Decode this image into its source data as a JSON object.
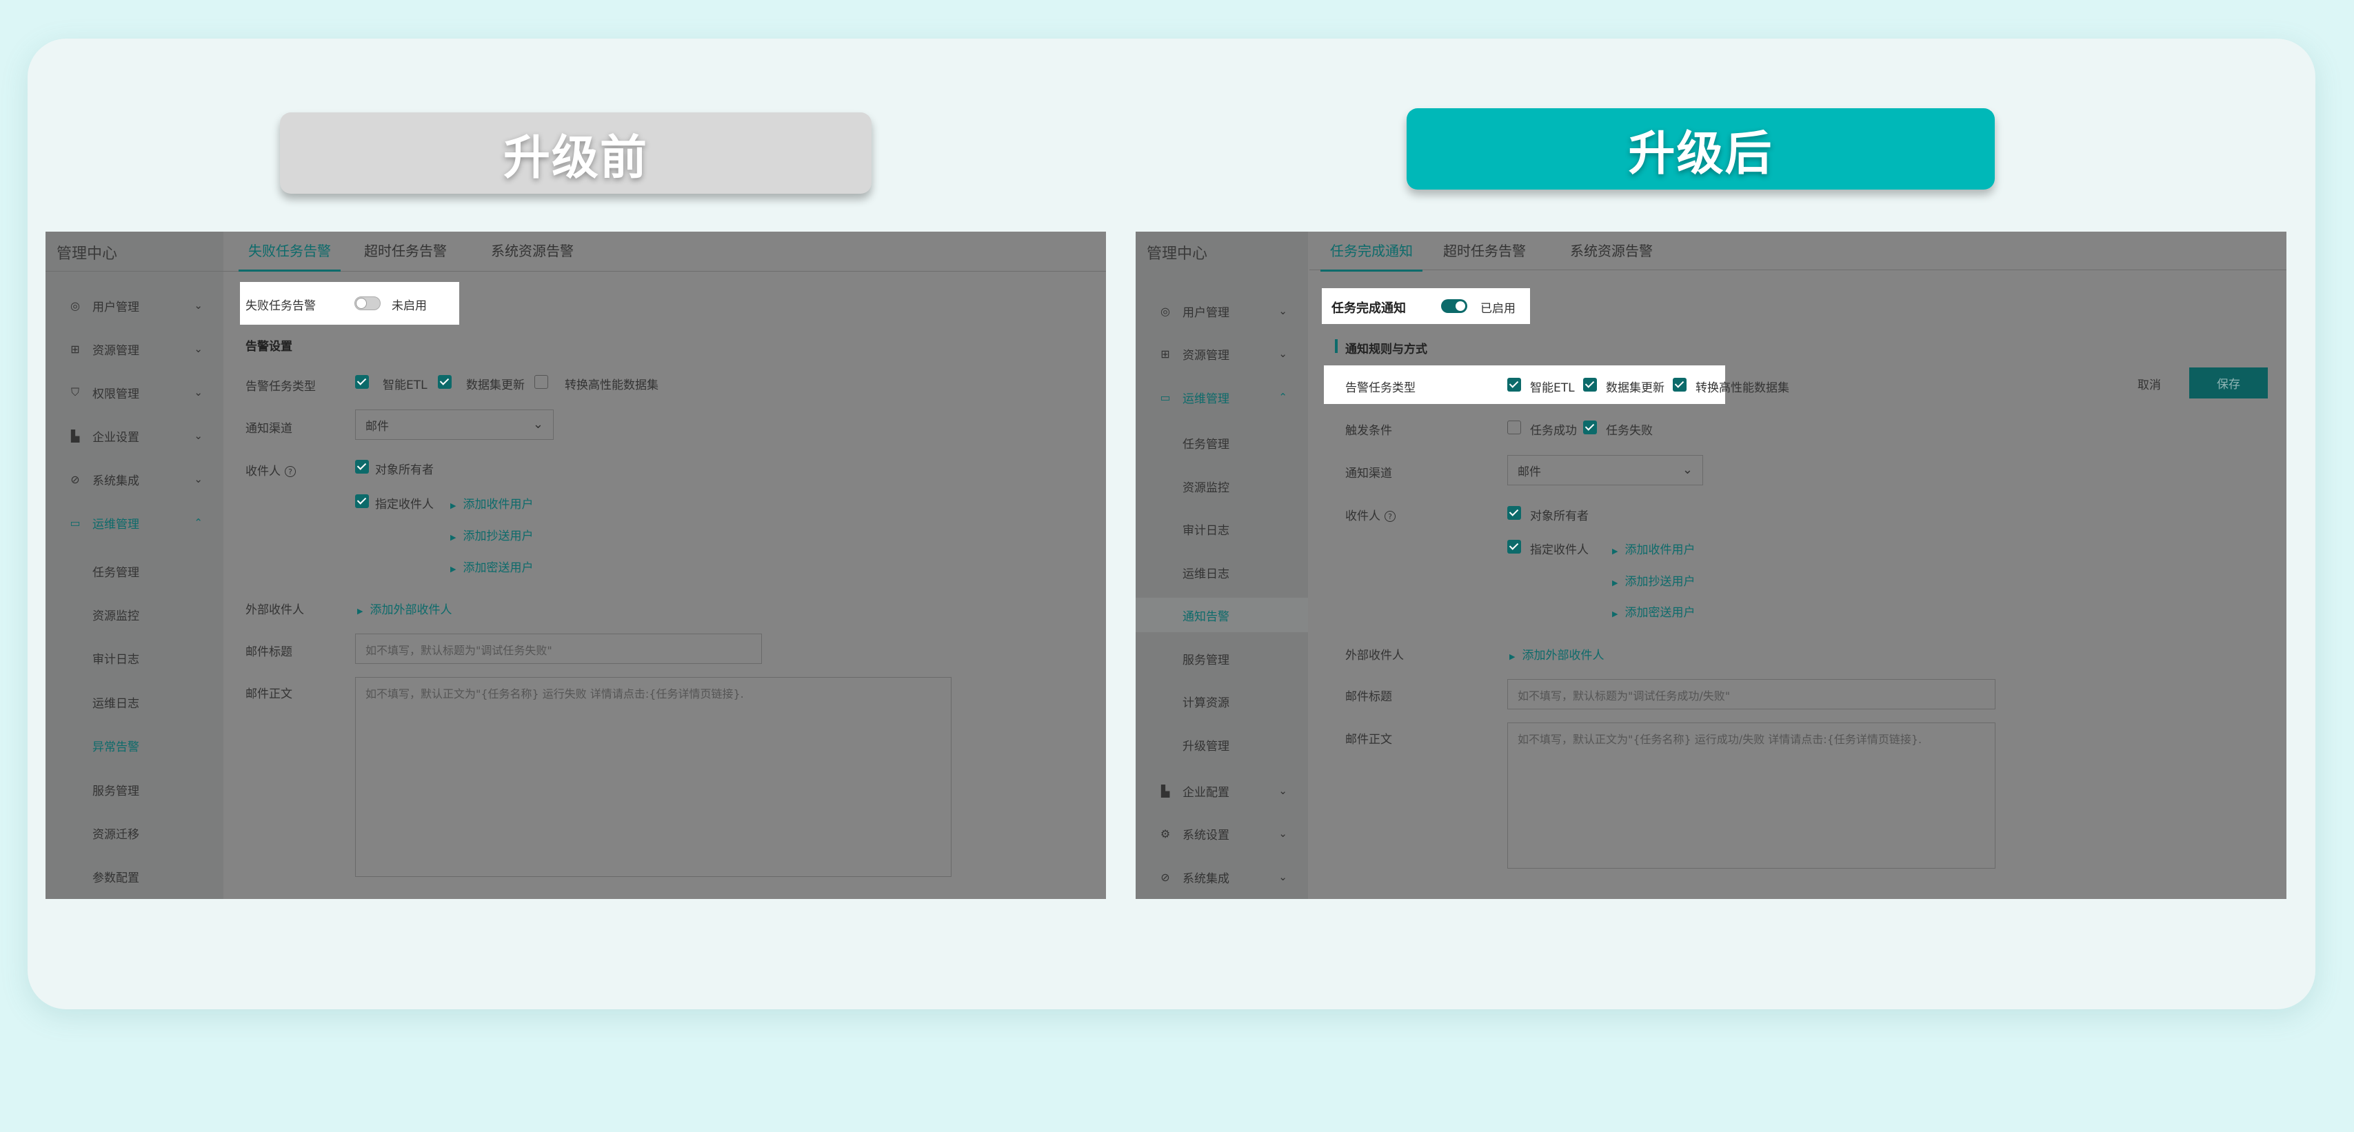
{
  "banners": {
    "before": "升级前",
    "after": "升级后"
  },
  "before": {
    "sidebar_title": "管理中心",
    "sidebar": [
      {
        "label": "用户管理",
        "icon": "user-icon"
      },
      {
        "label": "资源管理",
        "icon": "grid-icon"
      },
      {
        "label": "权限管理",
        "icon": "shield-icon"
      },
      {
        "label": "企业设置",
        "icon": "building-icon"
      },
      {
        "label": "系统集成",
        "icon": "integration-icon"
      },
      {
        "label": "运维管理",
        "icon": "monitor-icon"
      }
    ],
    "subitems": [
      "任务管理",
      "资源监控",
      "审计日志",
      "运维日志",
      "异常告警",
      "服务管理",
      "资源迁移",
      "参数配置"
    ],
    "tabs": [
      "失败任务告警",
      "超时任务告警",
      "系统资源告警"
    ],
    "toggle": {
      "label": "失败任务告警",
      "state": "未启用"
    },
    "section": "告警设置",
    "labels": {
      "task_type": "告警任务类型",
      "channel": "通知渠道",
      "recipient": "收件人",
      "external": "外部收件人",
      "subject": "邮件标题",
      "body": "邮件正文"
    },
    "task_types": [
      "智能ETL",
      "数据集更新",
      "转换高性能数据集"
    ],
    "channel_value": "邮件",
    "recipient_options": [
      "对象所有者",
      "指定收件人"
    ],
    "links": [
      "添加收件用户",
      "添加抄送用户",
      "添加密送用户",
      "添加外部收件人"
    ],
    "subject_placeholder": "如不填写，默认标题为\"调试任务失败\"",
    "body_placeholder": "如不填写，默认正文为\"{任务名称} 运行失败 详情请点击:{任务详情页链接}."
  },
  "after": {
    "sidebar_title": "管理中心",
    "sidebar": [
      {
        "label": "用户管理",
        "icon": "user-icon"
      },
      {
        "label": "资源管理",
        "icon": "grid-icon"
      },
      {
        "label": "运维管理",
        "icon": "monitor-icon"
      }
    ],
    "subitems": [
      "任务管理",
      "资源监控",
      "审计日志",
      "运维日志",
      "通知告警",
      "服务管理",
      "计算资源",
      "升级管理"
    ],
    "sidebar_bottom": [
      {
        "label": "企业配置",
        "icon": "building-icon"
      },
      {
        "label": "系统设置",
        "icon": "settings-icon"
      },
      {
        "label": "系统集成",
        "icon": "integration-icon"
      }
    ],
    "tabs": [
      "任务完成通知",
      "超时任务告警",
      "系统资源告警"
    ],
    "toggle": {
      "label": "任务完成通知",
      "state": "已启用"
    },
    "section": "通知规则与方式",
    "labels": {
      "task_type": "告警任务类型",
      "trigger": "触发条件",
      "channel": "通知渠道",
      "recipient": "收件人",
      "external": "外部收件人",
      "subject": "邮件标题",
      "body": "邮件正文"
    },
    "task_types": [
      "智能ETL",
      "数据集更新",
      "转换高性能数据集"
    ],
    "triggers": [
      "任务成功",
      "任务失败"
    ],
    "channel_value": "邮件",
    "recipient_options": [
      "对象所有者",
      "指定收件人"
    ],
    "links": [
      "添加收件用户",
      "添加抄送用户",
      "添加密送用户",
      "添加外部收件人"
    ],
    "subject_placeholder": "如不填写，默认标题为\"调试任务成功/失败\"",
    "body_placeholder": "如不填写，默认正文为\"{任务名称} 运行成功/失败 详情请点击:{任务详情页链接}.",
    "cancel": "取消",
    "save": "保存"
  }
}
